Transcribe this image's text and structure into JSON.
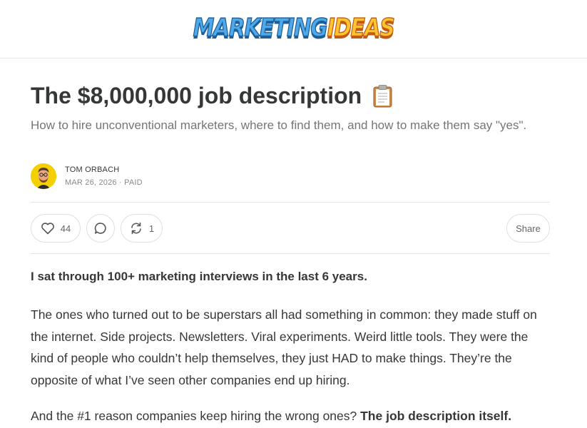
{
  "header": {
    "logo_part1": "MARKETING",
    "logo_part2": "IDEAS"
  },
  "post": {
    "title": "The $8,000,000 job description",
    "title_emoji_icon": "clipboard-icon",
    "subtitle": "How to hire unconventional marketers, where to find them, and how to make them say \"yes\".",
    "author": "TOM ORBACH",
    "meta": "MAR 26, 2026 · PAID"
  },
  "actions": {
    "likes": "44",
    "restacks": "1",
    "share_label": "Share"
  },
  "body": {
    "lead": "I sat through 100+ marketing interviews in the last 6 years.",
    "paragraph1": "The ones who turned out to be superstars all had something in common: they made stuff on the internet. Side projects. Newsletters. Viral experiments. Weird little tools. They were the kind of people who couldn’t help themselves, they just HAD to make things. They’re the opposite of what I’ve seen other companies end up hiring.",
    "paragraph2_start": "And the #1 reason companies keep hiring the wrong ones? ",
    "paragraph2_bold": "The job description itself."
  },
  "colors": {
    "text": "#363737",
    "muted": "#757575",
    "border": "#e6e6e6",
    "logo_blue": "#4fa8e8",
    "logo_yellow": "#ffc531",
    "avatar_bg": "#f5d000"
  }
}
